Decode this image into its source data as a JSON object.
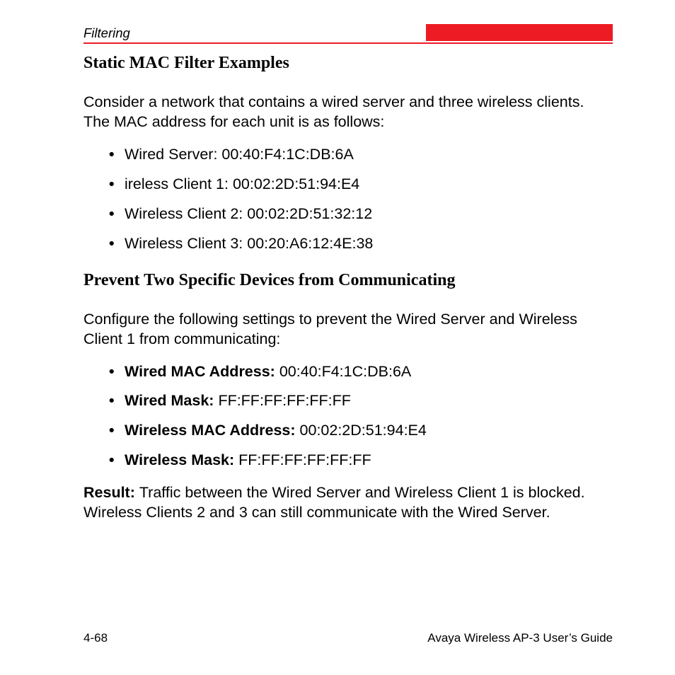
{
  "header": {
    "section_label": "Filtering"
  },
  "h1": "Static MAC Filter Examples",
  "intro": "Consider a network that contains a wired server and three wireless clients. The MAC address for each unit is as follows:",
  "list1": {
    "i0": "Wired Server: 00:40:F4:1C:DB:6A",
    "i1": "ireless Client 1: 00:02:2D:51:94:E4",
    "i2": "Wireless Client 2: 00:02:2D:51:32:12",
    "i3": "Wireless Client 3: 00:20:A6:12:4E:38"
  },
  "h2": "Prevent Two Specific Devices from Communicating",
  "para2": "Configure the following settings to prevent the Wired Server and Wireless Client 1 from communicating:",
  "list2": {
    "i0_label": "Wired MAC Address: ",
    "i0_val": "00:40:F4:1C:DB:6A",
    "i1_label": "Wired Mask: ",
    "i1_val": "FF:FF:FF:FF:FF:FF",
    "i2_label": "Wireless MAC Address: ",
    "i2_val": "00:02:2D:51:94:E4",
    "i3_label": "Wireless Mask: ",
    "i3_val": "FF:FF:FF:FF:FF:FF"
  },
  "result_label": "Result: ",
  "result_text": "Traffic between the Wired Server and Wireless Client 1 is blocked. Wireless Clients 2 and 3 can still communicate with the Wired Server.",
  "footer": {
    "page_num": "4-68",
    "guide": "Avaya Wireless AP-3 User’s Guide"
  }
}
